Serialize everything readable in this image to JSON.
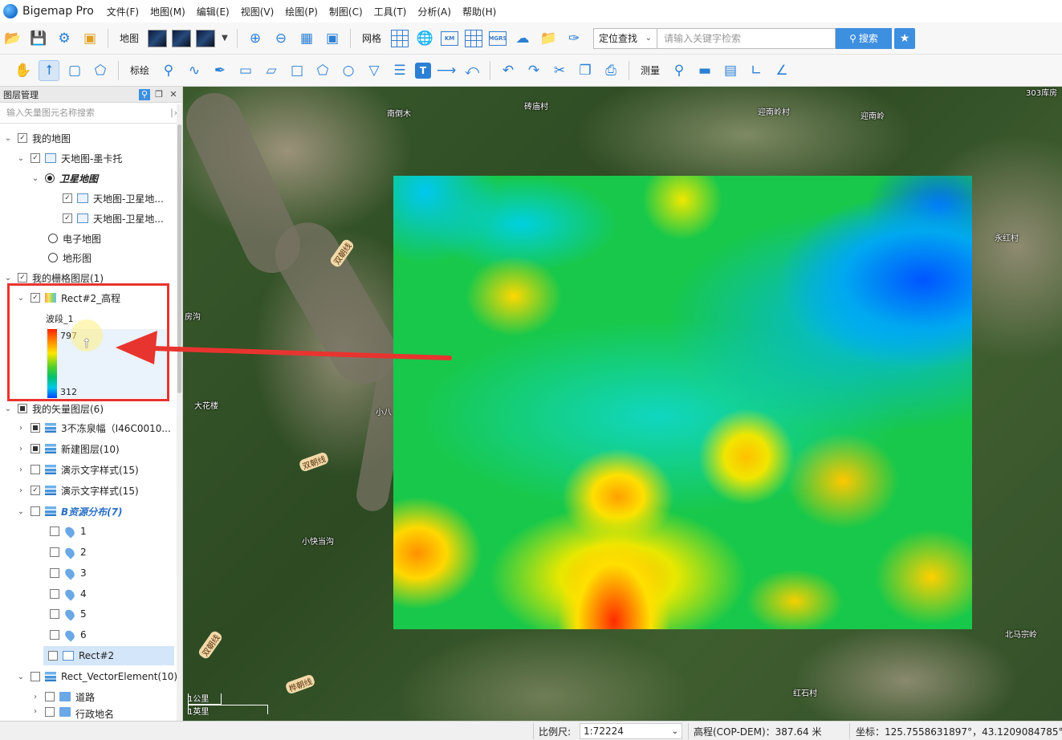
{
  "app": {
    "name": "Bigemap Pro"
  },
  "menu": [
    "文件(F)",
    "地图(M)",
    "编辑(E)",
    "视图(V)",
    "绘图(P)",
    "制图(C)",
    "工具(T)",
    "分析(A)",
    "帮助(H)"
  ],
  "toolbar1": {
    "map_label": "地图",
    "grid_label": "网格",
    "search_mode": "定位查找",
    "search_placeholder": "请输入关键字检索",
    "search_button": "搜索"
  },
  "toolbar2": {
    "mark_label": "标绘",
    "measure_label": "测量"
  },
  "panel": {
    "title": "图层管理",
    "search_placeholder": "输入矢量图元名称搜索",
    "tree": {
      "my_map": "我的地图",
      "tianditu": "天地图-墨卡托",
      "satellite": "卫星地图",
      "sat_sub1": "天地图-卫星地...",
      "sat_sub2": "天地图-卫星地...",
      "electronic": "电子地图",
      "terrain": "地形图",
      "raster_group": "我的栅格图层(1)",
      "raster_layer": "Rect#2_高程",
      "band": "波段_1",
      "legend_max": "797",
      "legend_min": "312",
      "vector_group": "我的矢量图层(6)",
      "v1": "3不冻泉幅（I46C0010...",
      "v2": "新建图层(10)",
      "v3": "演示文字样式(15)",
      "v4": "演示文字样式(15)",
      "v5": "B资源分布(7)",
      "p1": "1",
      "p2": "2",
      "p3": "3",
      "p4": "4",
      "p5": "5",
      "p6": "6",
      "rect2": "Rect#2",
      "rect_vector": "Rect_VectorElement(10)",
      "roads": "道路",
      "admin": "行政地名"
    }
  },
  "map_labels": {
    "l1": "303库房",
    "l2": "南倒木",
    "l3": "砖庙村",
    "l4": "迎南岭村",
    "l5": "迎南岭",
    "l6": "永红村",
    "l7": "房沟",
    "l8": "大花楼",
    "l9": "小八",
    "l10": "小快当沟",
    "l11": "北马宗岭",
    "l12": "红石村",
    "road1": "双朝线",
    "road2": "双朝线",
    "road3": "双朝线",
    "road4": "桦朝线"
  },
  "scale": {
    "km": "1公里",
    "mile": "1英里"
  },
  "status": {
    "scale_label": "比例尺:",
    "scale_value": "1:72224",
    "elevation": "高程(COP-DEM)：387.64 米",
    "coord": "坐标：125.7558631897°，43.1209084785°"
  }
}
